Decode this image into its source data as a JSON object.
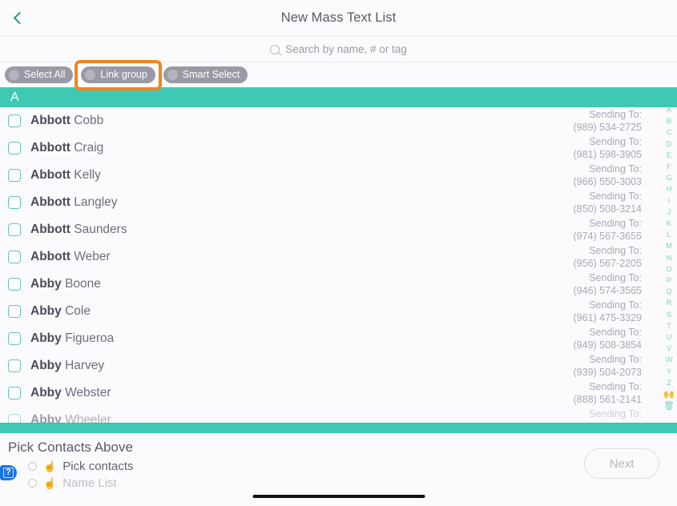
{
  "header": {
    "title": "New Mass Text List",
    "back_icon": "chevron-left-icon"
  },
  "search": {
    "placeholder": "Search by name, # or tag",
    "icon": "search-icon",
    "value": ""
  },
  "toolbar": {
    "buttons": [
      {
        "label": "Select All",
        "highlighted": false
      },
      {
        "label": "Link group",
        "highlighted": true
      },
      {
        "label": "Smart Select",
        "highlighted": false
      }
    ],
    "highlight_color": "#f3841f"
  },
  "section": {
    "letter": "A",
    "band_color": "#3fc9b4"
  },
  "list": {
    "sending_to_label": "Sending To:",
    "contacts": [
      {
        "first": "Abbott",
        "last": "Cobb",
        "phone": "(989) 534-2725",
        "checked": false
      },
      {
        "first": "Abbott",
        "last": "Craig",
        "phone": "(981) 598-3905",
        "checked": false
      },
      {
        "first": "Abbott",
        "last": "Kelly",
        "phone": "(966) 550-3003",
        "checked": false
      },
      {
        "first": "Abbott",
        "last": "Langley",
        "phone": "(850) 508-3214",
        "checked": false
      },
      {
        "first": "Abbott",
        "last": "Saunders",
        "phone": "(974) 567-3655",
        "checked": false
      },
      {
        "first": "Abbott",
        "last": "Weber",
        "phone": "(956) 567-2205",
        "checked": false
      },
      {
        "first": "Abby",
        "last": "Boone",
        "phone": "(946) 574-3565",
        "checked": false
      },
      {
        "first": "Abby",
        "last": "Cole",
        "phone": "(961) 475-3329",
        "checked": false
      },
      {
        "first": "Abby",
        "last": "Figueroa",
        "phone": "(949) 508-3854",
        "checked": false
      },
      {
        "first": "Abby",
        "last": "Harvey",
        "phone": "(939) 504-2073",
        "checked": false
      },
      {
        "first": "Abby",
        "last": "Webster",
        "phone": "(888) 561-2141",
        "checked": false
      },
      {
        "first": "Abby",
        "last": "Wheeler",
        "phone": "",
        "checked": false
      }
    ]
  },
  "alpha_index": {
    "letters": [
      "A",
      "B",
      "C",
      "D",
      "E",
      "F",
      "G",
      "H",
      "I",
      "J",
      "K",
      "L",
      "M",
      "N",
      "O",
      "P",
      "Q",
      "R",
      "S",
      "T",
      "U",
      "V",
      "W",
      "Y",
      "Z"
    ],
    "emoji": [
      "🙌",
      "🗑"
    ],
    "color": "#7fd4c4"
  },
  "bottom": {
    "title": "Pick Contacts Above",
    "options": [
      {
        "emoji": "☝",
        "label": "Pick contacts",
        "selected": false,
        "disabled": false
      },
      {
        "emoji": "☝",
        "label": "Name List",
        "selected": false,
        "disabled": true
      }
    ],
    "next_label": "Next",
    "help_icon": "question-mark-icon"
  }
}
